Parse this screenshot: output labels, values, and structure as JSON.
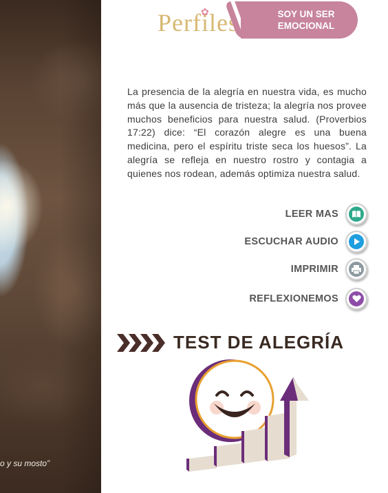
{
  "header": {
    "logo_text": "Perfiles",
    "badge_line1": "SOY UN SER",
    "badge_line2": "EMOCIONAL"
  },
  "photo": {
    "caption": "o y su mosto”"
  },
  "article": {
    "text": "La presencia de la alegría en nuestra vida, es mucho más que la ausencia de tristeza; la alegría nos provee muchos beneficios para nuestra salud. (Proverbios 17:22) dice: “El corazón alegre es una buena medicina, pero el espíritu triste seca los huesos”. La alegría se refleja en nuestro rostro y contagia a quienes nos rodean, además optimiza nuestra salud."
  },
  "actions": [
    {
      "label": "LEER MAS",
      "icon": "book-icon",
      "color": "#2fa98c"
    },
    {
      "label": "ESCUCHAR AUDIO",
      "icon": "play-icon",
      "color": "#1f9ee0"
    },
    {
      "label": "IMPRIMIR",
      "icon": "printer-icon",
      "color": "#8c9aa0"
    },
    {
      "label": "REFLEXIONEMOS",
      "icon": "heart-icon",
      "color": "#8e4ea8"
    }
  ],
  "test": {
    "title": "TEST DE ALEGRÍA"
  },
  "colors": {
    "brand_pink": "#c7849c",
    "logo_gold": "#d7b873",
    "heading_dark": "#3a2a22",
    "chevron": "#4a2e2a",
    "purple": "#6b2d7a"
  }
}
